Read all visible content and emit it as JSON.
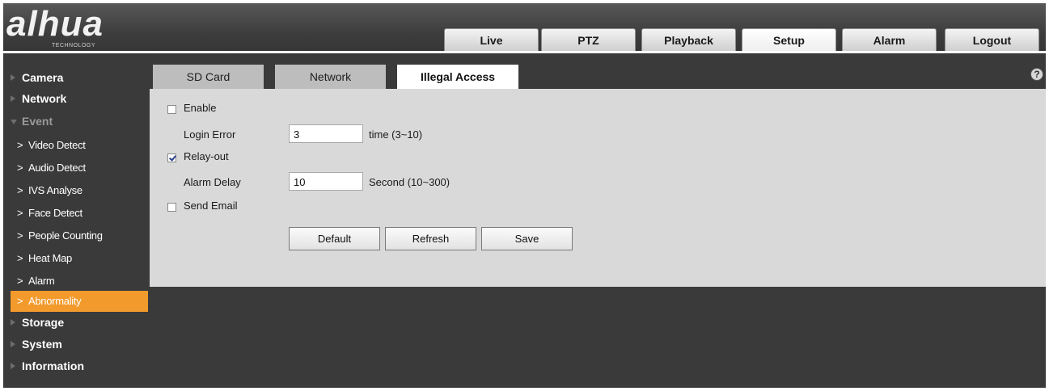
{
  "brand": {
    "logo_text": "alhua",
    "logo_subtext": "TECHNOLOGY"
  },
  "nav": {
    "tabs": [
      {
        "label": "Live"
      },
      {
        "label": "PTZ"
      },
      {
        "label": "Playback"
      },
      {
        "label": "Setup",
        "active": true
      },
      {
        "label": "Alarm"
      },
      {
        "label": "Logout"
      }
    ]
  },
  "sidebar": {
    "groups": [
      {
        "label": "Camera",
        "icon": "triangle-right-icon"
      },
      {
        "label": "Network",
        "icon": "triangle-right-icon"
      },
      {
        "label": "Event",
        "icon": "triangle-down-icon",
        "expanded": true
      },
      {
        "label": "Storage",
        "icon": "triangle-right-icon"
      },
      {
        "label": "System",
        "icon": "triangle-right-icon"
      },
      {
        "label": "Information",
        "icon": "triangle-right-icon"
      }
    ],
    "event_items": [
      {
        "label": "Video Detect"
      },
      {
        "label": "Audio Detect"
      },
      {
        "label": "IVS Analyse"
      },
      {
        "label": "Face Detect"
      },
      {
        "label": "People Counting"
      },
      {
        "label": "Heat Map"
      },
      {
        "label": "Alarm"
      },
      {
        "label": "Abnormality",
        "active": true
      }
    ]
  },
  "subtabs": [
    {
      "label": "SD Card"
    },
    {
      "label": "Network"
    },
    {
      "label": "Illegal Access",
      "active": true
    }
  ],
  "help_icon": "question-circle-icon",
  "form": {
    "enable": {
      "label": "Enable",
      "checked": false
    },
    "login_error": {
      "label": "Login Error",
      "value": "3",
      "hint": "time (3~10)"
    },
    "relay_out": {
      "label": "Relay-out",
      "checked": true
    },
    "alarm_delay": {
      "label": "Alarm Delay",
      "value": "10",
      "hint": "Second (10~300)"
    },
    "send_email": {
      "label": "Send Email",
      "checked": false
    },
    "buttons": {
      "default": "Default",
      "refresh": "Refresh",
      "save": "Save"
    }
  },
  "colors": {
    "accent": "#f29a2c",
    "panel": "#d9d9d9",
    "background": "#3a3a3a"
  }
}
